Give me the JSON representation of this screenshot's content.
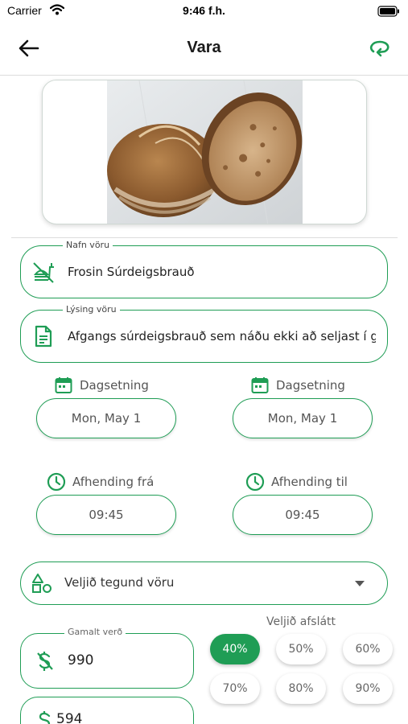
{
  "status_bar": {
    "carrier": "Carrier",
    "time": "9:46 f.h."
  },
  "nav": {
    "title": "Vara"
  },
  "product_image": {
    "alt": "bread-photo"
  },
  "name_field": {
    "legend": "Nafn vöru",
    "value": "Frosin Súrdeigsbrauð",
    "icon": "no-food-icon"
  },
  "description_field": {
    "legend": "Lýsing vöru",
    "value": "Afgangs súrdeigsbrauð sem náðu ekki að seljast í ga",
    "icon": "document-icon"
  },
  "dates": [
    {
      "label": "Dagsetning",
      "value": "Mon, May 1",
      "icon": "calendar-icon"
    },
    {
      "label": "Dagsetning",
      "value": "Mon, May 1",
      "icon": "calendar-icon"
    }
  ],
  "pickup": [
    {
      "label": "Afhending frá",
      "value": "09:45",
      "icon": "clock-icon"
    },
    {
      "label": "Afhending til",
      "value": "09:45",
      "icon": "clock-icon"
    }
  ],
  "category_select": {
    "placeholder": "Veljið tegund vöru",
    "icon": "shapes-icon"
  },
  "discount": {
    "title": "Veljið afslátt",
    "options": [
      "40%",
      "50%",
      "60%",
      "70%",
      "80%",
      "90%"
    ],
    "selected": "40%"
  },
  "old_price": {
    "legend": "Gamalt verð",
    "value": "990",
    "icon": "no-money-icon"
  },
  "new_price": {
    "value": "594",
    "icon": "dollar-icon"
  },
  "colors": {
    "accent": "#1f9d55",
    "text": "#222222",
    "muted": "#666666"
  }
}
